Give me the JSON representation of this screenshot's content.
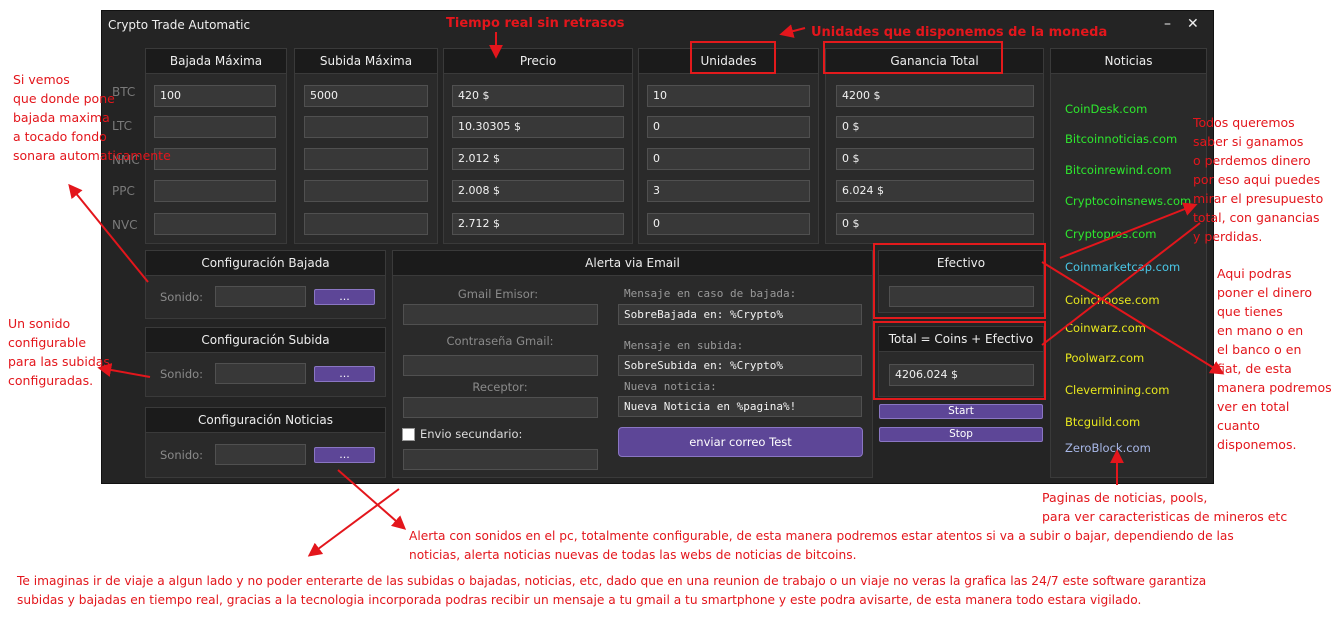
{
  "window": {
    "title": "Crypto Trade Automatic",
    "minimize": "–",
    "close": "✕"
  },
  "rows": [
    "BTC",
    "LTC",
    "NMC",
    "PPC",
    "NVC"
  ],
  "columns": {
    "bajada": {
      "header": "Bajada Máxima",
      "values": [
        "100",
        "",
        "",
        "",
        ""
      ]
    },
    "subida": {
      "header": "Subida Máxima",
      "values": [
        "5000",
        "",
        "",
        "",
        ""
      ]
    },
    "precio": {
      "header": "Precio",
      "values": [
        "420 $",
        "10.30305 $",
        "2.012 $",
        "2.008 $",
        "2.712 $"
      ]
    },
    "unidades": {
      "header": "Unidades",
      "values": [
        "10",
        "0",
        "0",
        "3",
        "0"
      ]
    },
    "ganancia": {
      "header": "Ganancia Total",
      "values": [
        "4200 $",
        "0 $",
        "0 $",
        "6.024 $",
        "0 $"
      ]
    }
  },
  "config": {
    "bajada": {
      "title": "Configuración Bajada",
      "sound_label": "Sonido:",
      "value": "",
      "button": "..."
    },
    "subida": {
      "title": "Configuración Subida",
      "sound_label": "Sonido:",
      "value": "",
      "button": "..."
    },
    "noticias": {
      "title": "Configuración Noticias",
      "sound_label": "Sonido:",
      "value": "",
      "button": "..."
    }
  },
  "email": {
    "title": "Alerta via Email",
    "gmail_label": "Gmail Emisor:",
    "gmail_value": "",
    "password_label": "Contraseña Gmail:",
    "password_value": "",
    "receptor_label": "Receptor:",
    "receptor_value": "",
    "secondary_label": "Envio secundario:",
    "secondary_value": "",
    "msg_bajada_label": "Mensaje en caso de bajada:",
    "msg_bajada_value": "SobreBajada en: %Crypto%",
    "msg_subida_label": "Mensaje en subida:",
    "msg_subida_value": "SobreSubida en: %Crypto%",
    "news_label": "Nueva noticia:",
    "news_value": "Nueva Noticia en %pagina%!",
    "test_button": "enviar correo Test"
  },
  "efectivo": {
    "title": "Efectivo",
    "value": ""
  },
  "total": {
    "title": "Total = Coins + Efectivo",
    "value": "4206.024 $"
  },
  "buttons": {
    "start": "Start",
    "stop": "Stop"
  },
  "noticias": {
    "title": "Noticias",
    "items": [
      {
        "label": "CoinDesk.com",
        "color": "#2ee82e"
      },
      {
        "label": "Bitcoinnoticias.com",
        "color": "#2ee82e"
      },
      {
        "label": "Bitcoinrewind.com",
        "color": "#2ee82e"
      },
      {
        "label": "Cryptocoinsnews.com",
        "color": "#2ee82e"
      },
      {
        "label": "Cryptopros.com",
        "color": "#2ee82e"
      },
      {
        "label": "Coinmarketcap.com",
        "color": "#49c8e8"
      },
      {
        "label": "Coinchoose.com",
        "color": "#e8e81e"
      },
      {
        "label": "Coinwarz.com",
        "color": "#e8e81e"
      },
      {
        "label": "Poolwarz.com",
        "color": "#e8e81e"
      },
      {
        "label": "Clevermining.com",
        "color": "#e8e81e"
      },
      {
        "label": "Btcguild.com",
        "color": "#e8e81e"
      },
      {
        "label": "ZeroBlock.com",
        "color": "#a8b8e8"
      }
    ]
  },
  "annotations": {
    "tiempo_real": "Tiempo real sin retrasos",
    "unidades_moneda": "Unidades que disponemos de la moneda",
    "bajada_maxima": [
      "Si vemos",
      "que donde pone",
      "bajada maxima",
      "a tocado fondo",
      "sonara automaticamente"
    ],
    "sonido_subidas": [
      "Un sonido",
      "configurable",
      "para las subidas",
      "configuradas."
    ],
    "ganamos": [
      "Todos queremos",
      "saber si ganamos",
      "o perdemos dinero",
      "por eso aqui puedes",
      "mirar el presupuesto",
      "total, con ganancias",
      "y perdidas."
    ],
    "dinero_fiat": [
      "Aqui podras",
      "poner el dinero",
      "que tienes",
      "en mano o en",
      "el banco o en",
      "fiat, de esta",
      "manera podremos",
      "ver en total",
      "cuanto",
      "disponemos."
    ],
    "paginas": [
      "Paginas de noticias, pools,",
      "para ver caracteristicas de mineros etc"
    ],
    "alerta": [
      "Alerta con sonidos en el pc, totalmente configurable, de esta manera podremos estar atentos si va a subir o bajar, dependiendo de las",
      "noticias, alerta noticias nuevas de todas las webs de noticias de bitcoins."
    ],
    "viaje": [
      "Te imaginas ir de viaje a algun lado y no poder enterarte de las subidas o bajadas, noticias, etc, dado que en una reunion de trabajo o un viaje no veras la grafica las 24/7 este software garantiza",
      "subidas y bajadas en tiempo real, gracias a la tecnologia incorporada podras recibir un mensaje a tu gmail a tu smartphone y este podra avisarte, de esta manera todo estara vigilado."
    ]
  },
  "colors": {
    "accent": "#5d4697",
    "annotation": "#e3161c",
    "background": "#242424"
  }
}
